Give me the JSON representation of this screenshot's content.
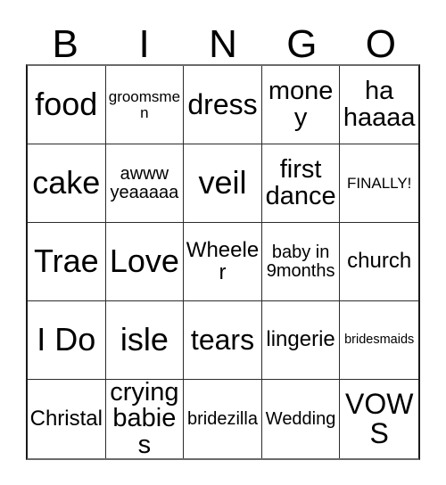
{
  "card": {
    "title_letters": [
      "B",
      "I",
      "N",
      "G",
      "O"
    ],
    "grid_size": "5x5",
    "colors": {
      "background": "#ffffff",
      "text": "#000000",
      "grid_line": "#2b2b2b",
      "outer_border": "#6b6b6b"
    },
    "rows": [
      [
        {
          "text": "food",
          "size": "t-xxl"
        },
        {
          "text": "groomsmen",
          "size": "t-xs"
        },
        {
          "text": "dress",
          "size": "t-xl"
        },
        {
          "text": "money",
          "size": "t-lg"
        },
        {
          "text": "ha\nhaaaa",
          "size": "t-lg"
        }
      ],
      [
        {
          "text": "cake",
          "size": "t-xxl"
        },
        {
          "text": "awww\nyeaaaaa",
          "size": "t-sm"
        },
        {
          "text": "veil",
          "size": "t-xxl"
        },
        {
          "text": "first\ndance",
          "size": "t-lg"
        },
        {
          "text": "FINALLY!",
          "size": "t-xs"
        }
      ],
      [
        {
          "text": "Trae",
          "size": "t-xxl"
        },
        {
          "text": "Love",
          "size": "t-xxl"
        },
        {
          "text": "Wheeler",
          "size": "t-md"
        },
        {
          "text": "baby in\n9months",
          "size": "t-sm"
        },
        {
          "text": "church",
          "size": "t-md"
        }
      ],
      [
        {
          "text": "I Do",
          "size": "t-xxl"
        },
        {
          "text": "isle",
          "size": "t-xxl"
        },
        {
          "text": "tears",
          "size": "t-xl"
        },
        {
          "text": "lingerie",
          "size": "t-md"
        },
        {
          "text": "bridesmaids",
          "size": "t-xxs"
        }
      ],
      [
        {
          "text": "Christal",
          "size": "t-md"
        },
        {
          "text": "crying\nbabies",
          "size": "t-lg"
        },
        {
          "text": "bridezilla",
          "size": "t-sm"
        },
        {
          "text": "Wedding",
          "size": "t-sm"
        },
        {
          "text": "VOWS",
          "size": "t-xl"
        }
      ]
    ]
  }
}
